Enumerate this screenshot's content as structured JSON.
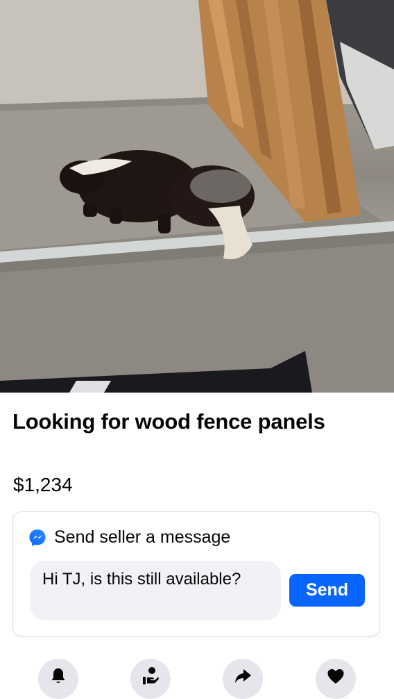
{
  "listing": {
    "title": "Looking for wood fence panels",
    "price": "$1,234"
  },
  "message_box": {
    "heading": "Send seller a message",
    "input_value": "Hi TJ, is this still available?",
    "send_label": "Send",
    "icon": "messenger-icon"
  },
  "actions": [
    {
      "icon": "bell-icon"
    },
    {
      "icon": "offer-icon"
    },
    {
      "icon": "share-icon"
    },
    {
      "icon": "heart-icon"
    }
  ],
  "colors": {
    "accent": "#0866ff",
    "action_bg": "#e4e6eb",
    "input_bg": "#f0f2f5",
    "card_border": "#dadde1"
  }
}
